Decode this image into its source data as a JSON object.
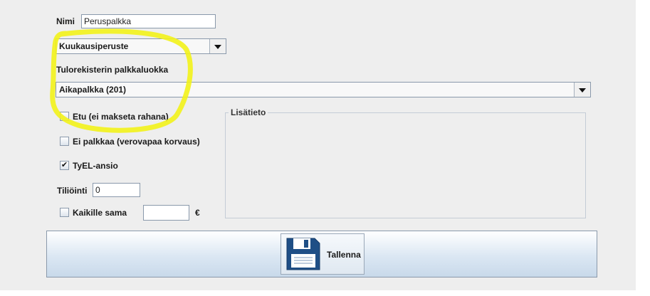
{
  "form": {
    "name_label": "Nimi",
    "name_value": "Peruspalkka",
    "basis_select": "Kuukausiperuste",
    "income_register_label": "Tulorekisterin palkkaluokka",
    "income_register_select": "Aikapalkka (201)",
    "benefit_checkbox": {
      "label": "Etu (ei makseta rahana)",
      "checked": false
    },
    "no_salary_checkbox": {
      "label": "Ei palkkaa (verovapaa korvaus)",
      "checked": false
    },
    "tyel_checkbox": {
      "label": "TyEL-ansio",
      "checked": true,
      "mark": "✔"
    },
    "account_label": "Tiliöinti",
    "account_value": "0",
    "same_for_all_checkbox": {
      "label": "Kaikille sama",
      "checked": false
    },
    "same_for_all_amount": "",
    "currency": "€",
    "additional_info_title": "Lisätieto",
    "save_button_label": "Tallenna"
  },
  "colors": {
    "panel_background": "#eeeeee",
    "highlight": "#f2f21a",
    "save_icon": "#1f4f86"
  },
  "icons": {
    "save": "floppy-disk-icon",
    "dropdown": "chevron-down-icon"
  }
}
